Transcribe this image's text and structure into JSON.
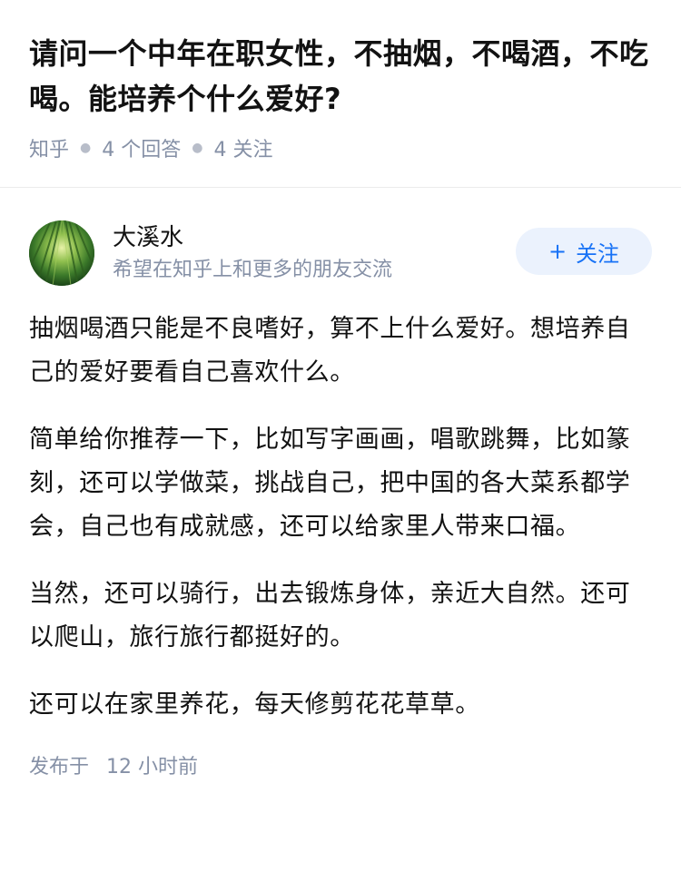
{
  "question": {
    "title": "请问一个中年在职女性，不抽烟，不喝酒，不吃喝。能培养个什么爱好?",
    "source": "知乎",
    "answers_count": "4 个回答",
    "followers_count": "4 关注"
  },
  "author": {
    "name": "大溪水",
    "bio": "希望在知乎上和更多的朋友交流",
    "follow_label": "关注",
    "follow_icon": "plus-icon"
  },
  "answer": {
    "paragraphs": [
      "抽烟喝酒只能是不良嗜好，算不上什么爱好。想培养自己的爱好要看自己喜欢什么。",
      "简单给你推荐一下，比如写字画画，唱歌跳舞，比如篆刻，还可以学做菜，挑战自己，把中国的各大菜系都学会，自己也有成就感，还可以给家里人带来口福。",
      "当然，还可以骑行，出去锻炼身体，亲近大自然。还可以爬山，旅行旅行都挺好的。",
      "还可以在家里养花，每天修剪花花草草。"
    ],
    "published_label": "发布于",
    "published_time": "12 小时前"
  },
  "colors": {
    "text": "#121212",
    "meta": "#8590a6",
    "accent": "#1772f6",
    "button_bg": "#ebf2fd"
  }
}
